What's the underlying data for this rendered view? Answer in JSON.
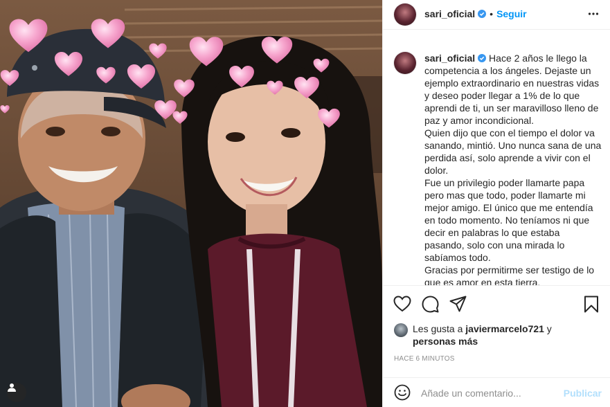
{
  "post": {
    "username": "sari_oficial",
    "dot": "•",
    "follow_label": "Seguir",
    "caption_username": "sari_oficial",
    "caption": "Hace 2 años le llego la competencia a los ángeles. Dejaste un ejemplo extraordinario en nuestras vidas y deseo poder llegar a 1% de lo que aprendi de ti, un ser maravilloso lleno de paz y amor incondicional.\nQuien dijo que con el tiempo el dolor va sanando, mintió. Uno nunca sana de una perdida así, solo aprende a vivir con el dolor.\nFue un privilegio poder llamarte papa pero mas que todo, poder llamarte mi mejor amigo. El único que me entendía en todo momento. No teníamos ni que decir en palabras lo que estaba pasando, solo con una mirada lo sabíamos todo.\nGracias por permitirme ser testigo de lo que es amor en esta tierra.\nTe amo demasiado y te extraño cada día",
    "likes_prefix": "Les gusta a ",
    "likes_user": "javiermarcelo721",
    "likes_middle": " y",
    "likes_others": "personas más",
    "timestamp": "HACE 6 MINUTOS"
  },
  "comment": {
    "placeholder": "Añade un comentario...",
    "publish_label": "Publicar"
  },
  "icons": {
    "verified": "verified-badge-icon",
    "more": "more-options-icon",
    "like": "heart-icon",
    "comment": "comment-icon",
    "share": "share-icon",
    "save": "bookmark-icon",
    "emoji": "emoji-icon",
    "user_tag": "user-tag-icon"
  },
  "colors": {
    "accent": "#0095f6",
    "publish_disabled": "#b2dffc",
    "muted": "#8e8e8e",
    "heart_pink": "#f7a8cf"
  }
}
